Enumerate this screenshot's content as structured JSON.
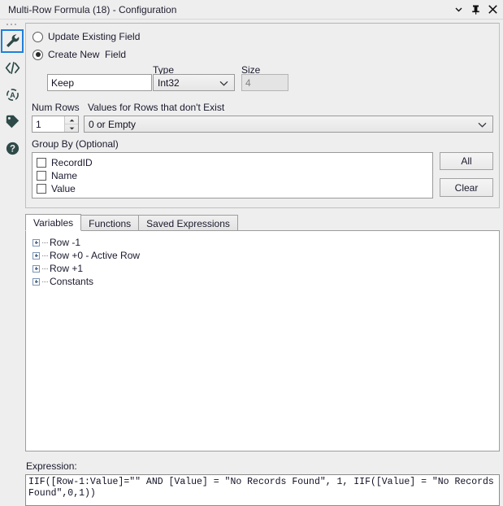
{
  "window": {
    "title": "Multi-Row Formula (18) - Configuration",
    "controls": [
      {
        "name": "dropdown-menu-icon",
        "glyph": "chevron-down-icon"
      },
      {
        "name": "pin-icon",
        "glyph": "pushpin-icon"
      },
      {
        "name": "close-icon",
        "glyph": "close-x-icon"
      }
    ]
  },
  "sidebar": {
    "items": [
      {
        "name": "configuration-tool-icon",
        "icon": "wrench-icon",
        "active": true
      },
      {
        "name": "xml-view-icon",
        "icon": "code-brackets-icon",
        "active": false
      },
      {
        "name": "annotation-icon",
        "icon": "target-a-icon",
        "active": false
      },
      {
        "name": "label-icon",
        "icon": "tag-icon",
        "active": false
      },
      {
        "name": "help-icon",
        "icon": "question-mark-icon",
        "active": false
      }
    ]
  },
  "config": {
    "update_existing_label": "Update Existing Field",
    "update_existing_checked": false,
    "create_new_label": "Create New  Field",
    "create_new_checked": true,
    "field_name_value": "Keep",
    "type_label": "Type",
    "type_value": "Int32",
    "size_label": "Size",
    "size_value": "4",
    "size_disabled": true,
    "num_rows_label": "Num Rows",
    "num_rows_value": "1",
    "values_for_rows_label": "Values for Rows that don't Exist",
    "values_for_rows_value": "0 or Empty",
    "group_by_label": "Group By (Optional)",
    "group_by_fields": [
      {
        "label": "RecordID",
        "checked": false
      },
      {
        "label": "Name",
        "checked": false
      },
      {
        "label": "Value",
        "checked": false
      }
    ],
    "all_button": "All",
    "clear_button": "Clear"
  },
  "tabs": [
    {
      "label": "Variables",
      "active": true
    },
    {
      "label": "Functions",
      "active": false
    },
    {
      "label": "Saved Expressions",
      "active": false
    }
  ],
  "tree": {
    "nodes": [
      {
        "label": "Row -1",
        "expanded": false
      },
      {
        "label": "Row +0 - Active Row",
        "expanded": false
      },
      {
        "label": "Row +1",
        "expanded": false
      },
      {
        "label": "Constants",
        "expanded": false
      }
    ]
  },
  "expression": {
    "label": "Expression:",
    "value": "IIF([Row-1:Value]=\"\" AND [Value] = \"No Records Found\", 1, IIF([Value] = \"No Records Found\",0,1))"
  },
  "colors": {
    "window_bg": "#eeeeee",
    "accent_selected": "#1e80d8",
    "icon_dark": "#2d4a48",
    "text": "#1a1a2e",
    "field_bg": "#ffffff"
  }
}
